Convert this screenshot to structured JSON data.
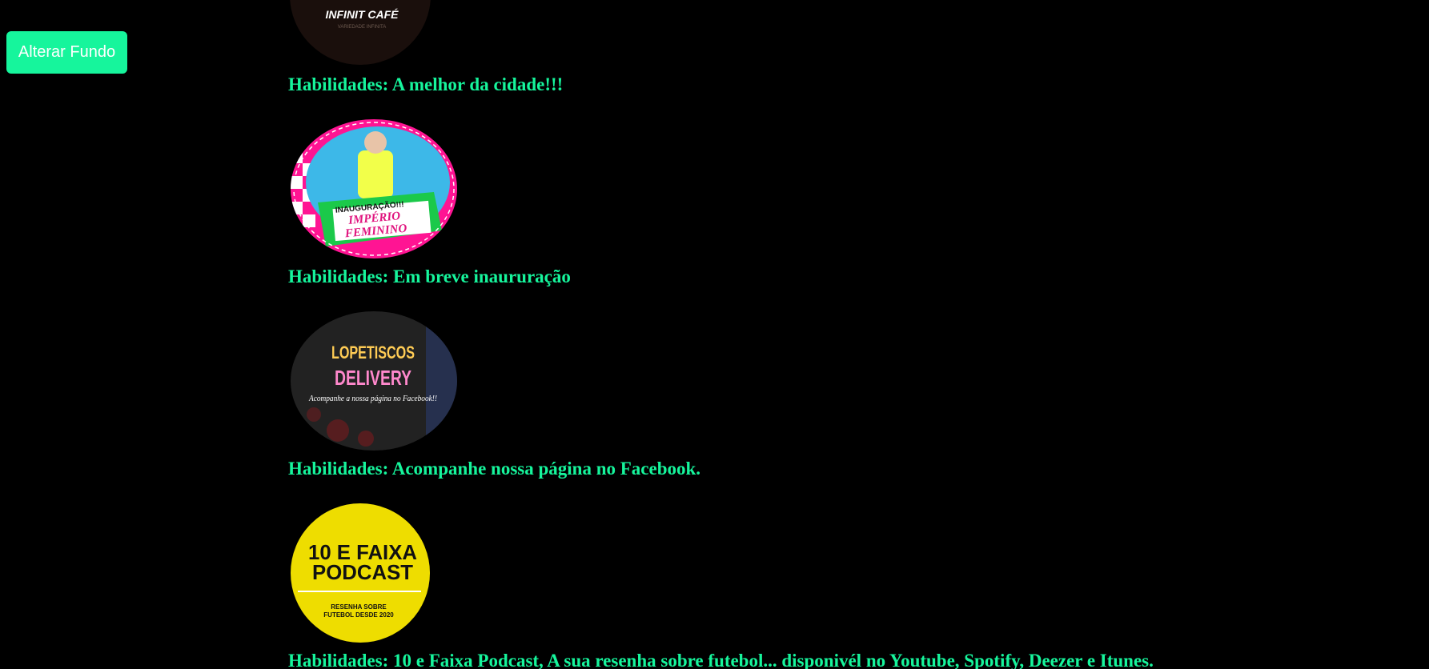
{
  "controls": {
    "change_background_label": "Alterar Fundo"
  },
  "colors": {
    "page_background": "#000000",
    "accent": "#16f59c"
  },
  "items": [
    {
      "logo_text": "INFINIT CAFÉ",
      "logo_subtext": "VARIEDADE INFINITA",
      "caption": "Habilidades: A melhor da cidade!!!"
    },
    {
      "logo_header": "INAUGURAÇÃO!!!",
      "logo_title_line1": "IMPÉRIO",
      "logo_title_line2": "FEMININO",
      "caption": "Habilidades: Em breve inaururação"
    },
    {
      "logo_title_line1": "LOPETISCOS",
      "logo_title_line2": "DELIVERY",
      "logo_subtext": "Acompanhe a nossa página no Facebook!!",
      "caption": "Habilidades: Acompanhe nossa página no Facebook."
    },
    {
      "logo_title_line1": "10 E FAIXA",
      "logo_title_line2": "PODCAST",
      "logo_subtext_line1": "RESENHA SOBRE",
      "logo_subtext_line2": "FUTEBOL DESDE 2020",
      "caption": "Habilidades: 10 e Faixa Podcast, A sua resenha sobre futebol... disponivél no Youtube, Spotify, Deezer e Itunes."
    }
  ]
}
